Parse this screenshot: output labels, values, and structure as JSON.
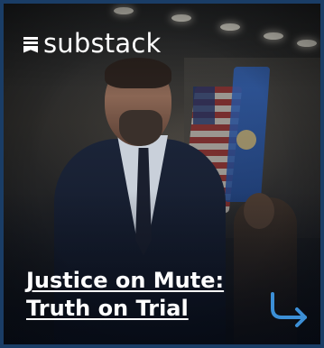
{
  "brand": {
    "name": "substack",
    "icon": "substack-logo-icon",
    "color": "#ffffff"
  },
  "article": {
    "title_line_1": "Justice on Mute:",
    "title_line_2": "Truth on Trial"
  },
  "action": {
    "icon": "curved-arrow-right-icon",
    "color": "#3c8fd6"
  },
  "frame": {
    "border_color": "#1a3d66"
  }
}
